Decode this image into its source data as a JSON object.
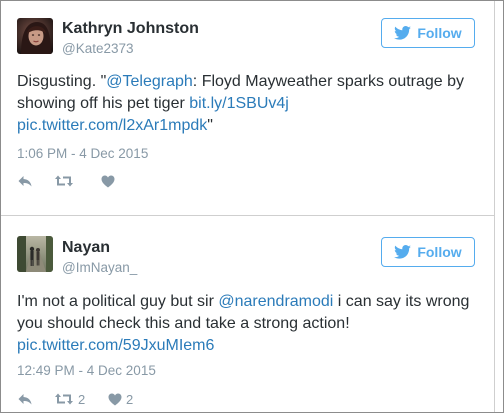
{
  "colors": {
    "link": "#2b7bb9",
    "twitter_blue": "#55acee",
    "muted": "#8899a6",
    "text": "#292f33"
  },
  "tweets": [
    {
      "name": "Kathryn Johnston",
      "handle": "@Kate2373",
      "follow_label": "Follow",
      "text_before": "Disgusting.  \"",
      "mention": "@Telegraph",
      "text_middle": ": Floyd Mayweather sparks outrage by showing off his pet tiger ",
      "link1": "bit.ly/1SBUv4j",
      "link2": "pic.twitter.com/l2xAr1mpdk",
      "text_after": "\"",
      "timestamp": "1:06 PM - 4 Dec 2015",
      "retweets": "",
      "likes": "",
      "icons": [
        "reply-icon",
        "retweet-icon",
        "heart-icon",
        "twitter-bird-icon"
      ]
    },
    {
      "name": "Nayan",
      "handle": "@ImNayan_",
      "follow_label": "Follow",
      "text_before": "I'm not a political guy but sir ",
      "mention": "@narendramodi",
      "text_middle": " i can say its wrong you should check this and take a strong action!",
      "link1": "pic.twitter.com/59JxuMIem6",
      "timestamp": "12:49 PM - 4 Dec 2015",
      "retweets": "2",
      "likes": "2",
      "icons": [
        "reply-icon",
        "retweet-icon",
        "heart-icon",
        "twitter-bird-icon"
      ]
    }
  ]
}
